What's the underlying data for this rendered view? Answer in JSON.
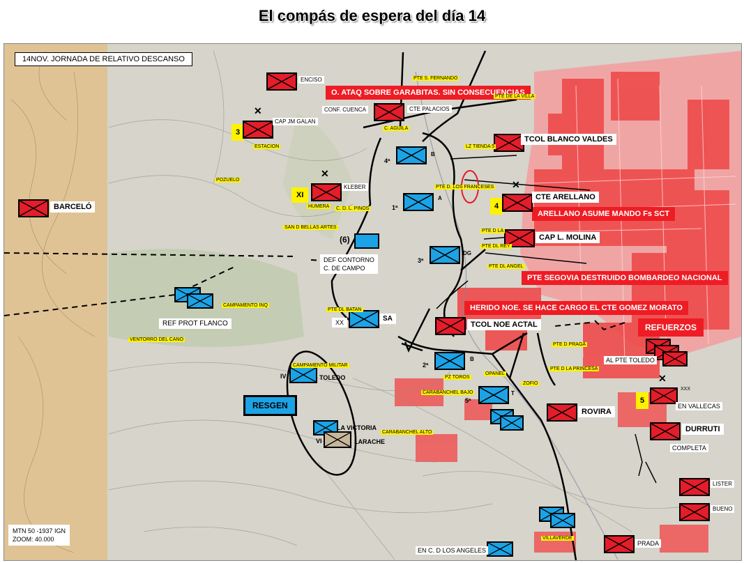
{
  "title": "El compás de espera del día 14",
  "header": "14NOV. JORNADA DE RELATIVO DESCANSO",
  "scale": {
    "line1": "MTN 50 -1937 IGN",
    "line2": "ZOOM: 40.000"
  },
  "colors": {
    "nationalist": "#1ca3e6",
    "republican": "#e41d2a",
    "moroccan": "#c6b79a",
    "banner": "#ee1c24",
    "highlight": "#fff200"
  },
  "banners": {
    "b1": "O. ATAQ SOBRE GARABITAS. SIN CONSECUENCIAS",
    "b2": "ARELLANO ASUME MANDO Fs SCT",
    "b3": "PTE SEGOVIA DESTRUIDO BOMBARDEO NACIONAL",
    "b4": "HERIDO NOE. SE HACE CARGO EL CTE GOMEZ MORATO",
    "b5": "REFUERZOS"
  },
  "labels": {
    "enciso": "ENCISO",
    "conf_cuenca": "CONF. CUENCA",
    "cte_palacios": "CTE PALACIOS",
    "cap_jm_galan": "CAP JM GALAN",
    "barcelo": "BARCELÓ",
    "kleber": "KLEBER",
    "tcol_blanco": "TCOL BLANCO VALDES",
    "cte_arellano": "CTE ARELLANO",
    "cap_molina": "CAP L. MOLINA",
    "def_contorno_1": "DEF CONTORNO",
    "def_contorno_2": "C. DE CAMPO",
    "ref_prot": "REF PROT FLANCO",
    "tcol_noe": "TCOL NOE ACTAL",
    "al_pte_toledo": "AL PTE TOLEDO",
    "en_vallecas": "EN VALLECAS",
    "rovira": "ROVIRA",
    "durruti": "DURRUTI",
    "completa": "COMPLETA",
    "lister": "LISTER",
    "bueno": "BUENO",
    "prada": "PRADA",
    "en_c_angeles": "EN C. D LOS ANGELES",
    "toledo": "TOLEDO",
    "victoria": "LA VICTORIA",
    "larache": "LARACHE",
    "resgen": "RESGEN"
  },
  "yellow_numbers": {
    "n3": "3",
    "xi": "XI",
    "n4": "4",
    "n5": "5"
  },
  "unit_marks": {
    "b4": "4ª",
    "b4_letter": "B",
    "b1": "1ª",
    "b1_letter": "A",
    "b3": "3ª",
    "b3_letter": "DG",
    "b6": "(6)",
    "xx": "XX",
    "sa": "SA",
    "b2": "2ª",
    "b2_letter": "B",
    "b5": "5ª",
    "b5_letter": "T",
    "iv": "IV",
    "vi": "VI",
    "xxx": "XXX"
  },
  "place_tags": {
    "p1": "PTE S. FERNANDO",
    "p2": "PTE DE LA VILLA",
    "p3": "C. AGUILA",
    "p4": "LZ TIENDA 5",
    "p5": "PTE D. LOS FRANCESES",
    "p6": "ESTACION",
    "p7": "POZUELO",
    "p8": "HUMERA",
    "p9": "C. D. L. PINOS",
    "p10": "SAN D BELLAS ARTES",
    "p11": "PTE D LA",
    "p12": "PTE DL REY",
    "p13": "PTE DL ANGEL",
    "p14": "CAMPAMENTO INQ",
    "p15": "PTE DL BATAN",
    "p16": "VENTORRO DEL CANO",
    "p17": "PTE D PRAGA",
    "p18": "PTE D LA PRINCESA",
    "p19": "CAMPAMENTO MILITAR",
    "p20": "PZ TOROS",
    "p21": "CARABANCHEL BAJO",
    "p22": "CARABANCHEL ALTO",
    "p23": "VILLAVERDE",
    "p24": "OPANEL",
    "p25": "ZOFIO"
  }
}
